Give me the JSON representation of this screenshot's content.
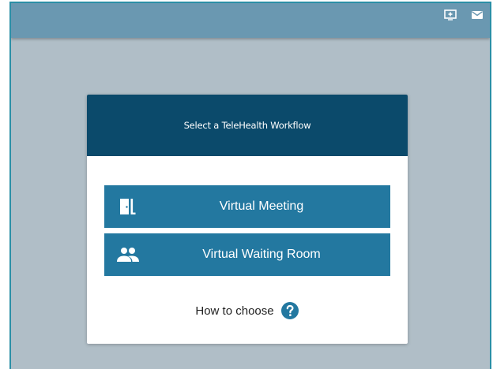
{
  "topbar": {
    "icons": [
      "present-to-all-icon",
      "mail-icon"
    ]
  },
  "dialog": {
    "title": "Select a TeleHealth Workflow",
    "buttons": [
      {
        "label": "Virtual Meeting",
        "icon": "door-exit-icon"
      },
      {
        "label": "Virtual Waiting Room",
        "icon": "people-group-icon"
      }
    ],
    "help_text": "How to choose",
    "help_icon": "help-circle-icon"
  },
  "colors": {
    "background": "#b0bec7",
    "topbar": "#6a98b1",
    "header": "#0b4a6b",
    "button": "#2378a0",
    "frame_border": "#2b8fa6"
  }
}
